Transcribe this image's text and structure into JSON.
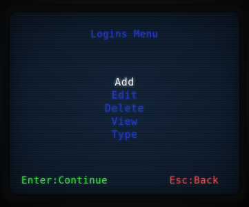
{
  "screen": {
    "title": "Logins Menu",
    "menu_items": [
      {
        "label": "Add",
        "selected": true
      },
      {
        "label": "Edit",
        "selected": false
      },
      {
        "label": "Delete",
        "selected": false
      },
      {
        "label": "View",
        "selected": false
      },
      {
        "label": "Type",
        "selected": false
      }
    ],
    "footer": {
      "enter_hint": "Enter:Continue",
      "esc_hint": "Esc:Back"
    }
  },
  "colors": {
    "title": "#2236c8",
    "menu_item": "#2236c8",
    "menu_item_selected": "#f2f4f7",
    "enter_hint": "#46d64a",
    "esc_hint": "#d8484c",
    "screen_background": "#0c1b2c"
  }
}
